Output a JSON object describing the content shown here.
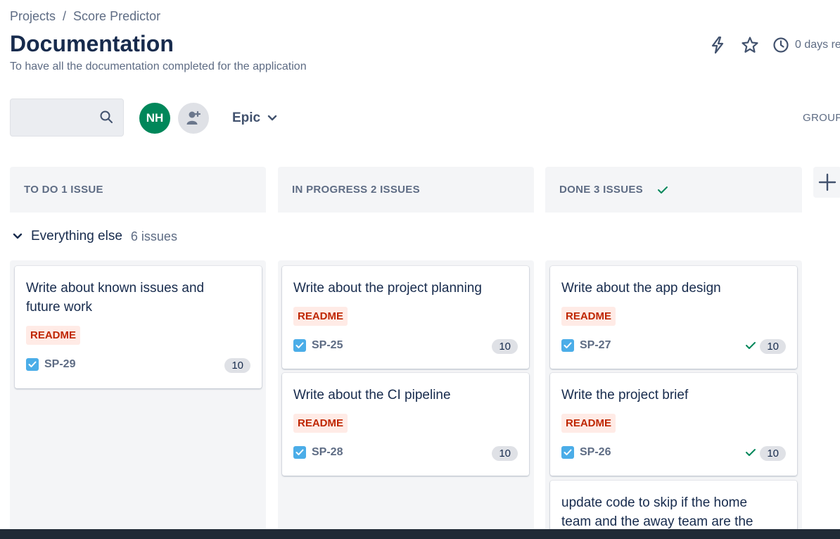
{
  "breadcrumb": {
    "projects": "Projects",
    "separator": "/",
    "project": "Score Predictor"
  },
  "header": {
    "title": "Documentation",
    "subtitle": "To have all the documentation completed for the application",
    "days_text": "0 days re"
  },
  "toolbar": {
    "avatar_initials": "NH",
    "epic_label": "Epic",
    "group_label": "GROUP"
  },
  "columns": [
    {
      "label": "TO DO 1 ISSUE"
    },
    {
      "label": "IN PROGRESS 2 ISSUES"
    },
    {
      "label": "DONE 3 ISSUES"
    }
  ],
  "swimlane": {
    "label": "Everything else",
    "count": "6 issues"
  },
  "cards": {
    "sp29": {
      "title": "Write about known issues and future work",
      "label": "README",
      "key": "SP-29",
      "points": "10"
    },
    "sp25": {
      "title": "Write about the project planning",
      "label": "README",
      "key": "SP-25",
      "points": "10"
    },
    "sp28": {
      "title": "Write about the CI pipeline",
      "label": "README",
      "key": "SP-28",
      "points": "10"
    },
    "sp27": {
      "title": "Write about the app design",
      "label": "README",
      "key": "SP-27",
      "points": "10"
    },
    "sp26": {
      "title": "Write the project brief",
      "label": "README",
      "key": "SP-26",
      "points": "10"
    },
    "partial": {
      "title": "update code to skip if the home team and the away team are the"
    }
  },
  "colors": {
    "label_bg": "#ffebe6",
    "label_text": "#bf2600",
    "avatar": "#00875a",
    "done_check": "#00875a",
    "task_icon": "#4bade8"
  }
}
